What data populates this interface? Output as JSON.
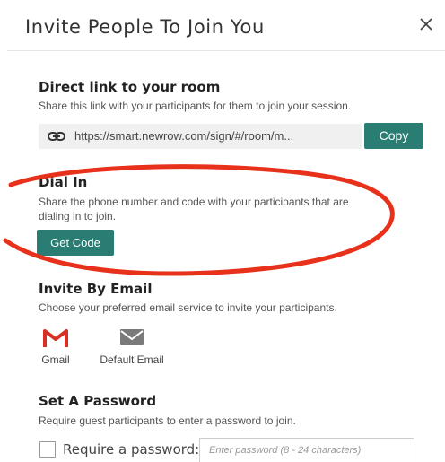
{
  "dialog": {
    "title": "Invite People To Join You",
    "close_icon": "close-icon"
  },
  "direct_link": {
    "title": "Direct link to your room",
    "description": "Share this link with your participants for them to join your session.",
    "url": "https://smart.newrow.com/sign/#/room/m...",
    "link_icon": "link-icon",
    "copy_label": "Copy"
  },
  "dial_in": {
    "title": "Dial In",
    "description_line1": "Share the phone number and code with your participants that are",
    "description_line2": "dialing in to join.",
    "get_code_label": "Get Code"
  },
  "invite_email": {
    "title": "Invite By Email",
    "description": "Choose your preferred email service to invite your participants.",
    "options": [
      {
        "label": "Gmail",
        "icon": "gmail-icon"
      },
      {
        "label": "Default Email",
        "icon": "envelope-icon"
      }
    ]
  },
  "password": {
    "title": "Set A Password",
    "description": "Require guest participants to enter a password to join.",
    "checkbox_label": "Require a password:",
    "input_placeholder": "Enter password (8 - 24 characters)",
    "input_value": ""
  },
  "colors": {
    "accent": "#2a7d73",
    "annotation": "#e8311a",
    "gmail_red": "#d93025"
  }
}
